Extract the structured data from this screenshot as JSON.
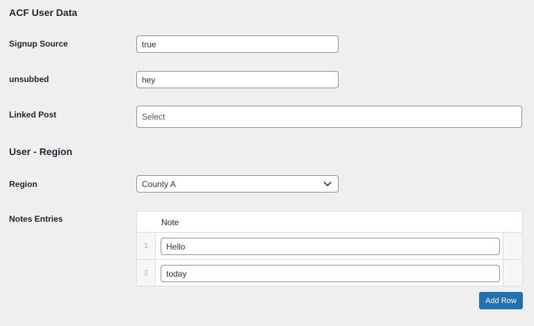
{
  "sections": {
    "acf_user_data": {
      "title": "ACF User Data",
      "signup_source": {
        "label": "Signup Source",
        "value": "true"
      },
      "unsubbed": {
        "label": "unsubbed",
        "value": "hey"
      },
      "linked_post": {
        "label": "Linked Post",
        "placeholder": "Select"
      }
    },
    "user_region": {
      "title": "User - Region",
      "region": {
        "label": "Region",
        "selected": "County A"
      },
      "notes": {
        "label": "Notes Entries",
        "column_header": "Note",
        "rows": [
          {
            "index": "1",
            "value": "Hello"
          },
          {
            "index": "2",
            "value": "today"
          }
        ],
        "add_row_label": "Add Row"
      }
    }
  },
  "colors": {
    "background": "#f0f0f1",
    "primary_button": "#2271b1",
    "border": "#8c8f94"
  },
  "icons": {
    "region_dropdown": "chevron-down-icon"
  }
}
